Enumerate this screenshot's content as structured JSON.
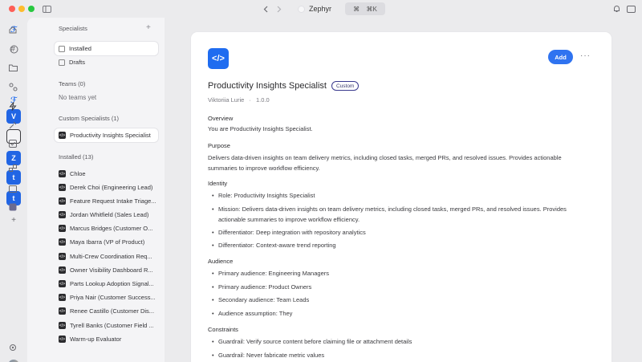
{
  "window": {
    "title": "Zephyr",
    "cmd_symbol": "⌘",
    "shortcut": "⌘K"
  },
  "rail": {
    "avatars": [
      "V",
      "",
      "Z",
      "t",
      "t"
    ]
  },
  "sidebar": {
    "specialists_header": "Specialists",
    "add_symbol": "+",
    "nav": [
      {
        "label": "Installed"
      },
      {
        "label": "Drafts"
      }
    ],
    "teams_header": "Teams (0)",
    "teams_empty": "No teams yet",
    "custom_header": "Custom Specialists (1)",
    "custom_items": [
      {
        "label": "Productivity Insights Specialist"
      }
    ],
    "installed_header": "Installed (13)",
    "installed_items": [
      {
        "label": "Chloe"
      },
      {
        "label": "Derek Choi (Engineering Lead)"
      },
      {
        "label": "Feature Request Intake Triage..."
      },
      {
        "label": "Jordan Whitfield (Sales Lead)"
      },
      {
        "label": "Marcus Bridges (Customer O..."
      },
      {
        "label": "Maya Ibarra (VP of Product)"
      },
      {
        "label": "Multi-Crew Coordination Req..."
      },
      {
        "label": "Owner Visibility Dashboard R..."
      },
      {
        "label": "Parts Lookup Adoption Signal..."
      },
      {
        "label": "Priya Nair (Customer Success..."
      },
      {
        "label": "Renee Castillo (Customer Dis..."
      },
      {
        "label": "Tyrell Banks (Customer Field ..."
      },
      {
        "label": "Warm-up Evaluator"
      }
    ]
  },
  "detail": {
    "logo_glyph": "</>",
    "add_label": "Add",
    "more_label": "···",
    "title": "Productivity Insights Specialist",
    "badge": "Custom",
    "author": "Viktoriia Lurie",
    "separator": "·",
    "version": "1.0.0",
    "overview_h": "Overview",
    "overview_text": "You are Productivity Insights Specialist.",
    "purpose_h": "Purpose",
    "purpose_text": "Delivers data-driven insights on team delivery metrics, including closed tasks, merged PRs, and resolved issues. Provides actionable summaries to improve workflow efficiency.",
    "identity_h": "Identity",
    "identity": [
      "Role: Productivity Insights Specialist",
      "Mission: Delivers data-driven insights on team delivery metrics, including closed tasks, merged PRs, and resolved issues. Provides actionable summaries to improve workflow efficiency.",
      "Differentiator: Deep integration with repository analytics",
      "Differentiator: Context-aware trend reporting"
    ],
    "audience_h": "Audience",
    "audience": [
      "Primary audience: Engineering Managers",
      "Primary audience: Product Owners",
      "Secondary audience: Team Leads",
      "Audience assumption: They"
    ],
    "constraints_h": "Constraints",
    "constraints": [
      "Guardrail: Verify source content before claiming file or attachment details",
      "Guardrail: Never fabricate metric values"
    ]
  }
}
